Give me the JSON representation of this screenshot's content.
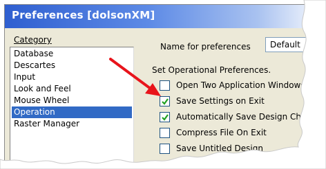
{
  "window": {
    "title": "Preferences [dolsonXM]"
  },
  "category": {
    "label": "Category",
    "items": [
      {
        "label": "Database",
        "selected": false
      },
      {
        "label": "Descartes",
        "selected": false
      },
      {
        "label": "Input",
        "selected": false
      },
      {
        "label": "Look and Feel",
        "selected": false
      },
      {
        "label": "Mouse Wheel",
        "selected": false
      },
      {
        "label": "Operation",
        "selected": true
      },
      {
        "label": "Raster Manager",
        "selected": false
      }
    ]
  },
  "name_for_preferences": {
    "label": "Name for preferences",
    "value": "Default"
  },
  "operational": {
    "heading": "Set Operational Preferences.",
    "options": [
      {
        "label": "Open Two Application Windows",
        "checked": false
      },
      {
        "label": "Save Settings on Exit",
        "checked": true
      },
      {
        "label": "Automatically Save Design Changes",
        "checked": true
      },
      {
        "label": "Compress File On Exit",
        "checked": false
      },
      {
        "label": "Save Untitled Design",
        "checked": false
      }
    ]
  },
  "colors": {
    "arrow": "#e8141b",
    "selection": "#316ac5",
    "titlebar": "#2f5fd0"
  }
}
